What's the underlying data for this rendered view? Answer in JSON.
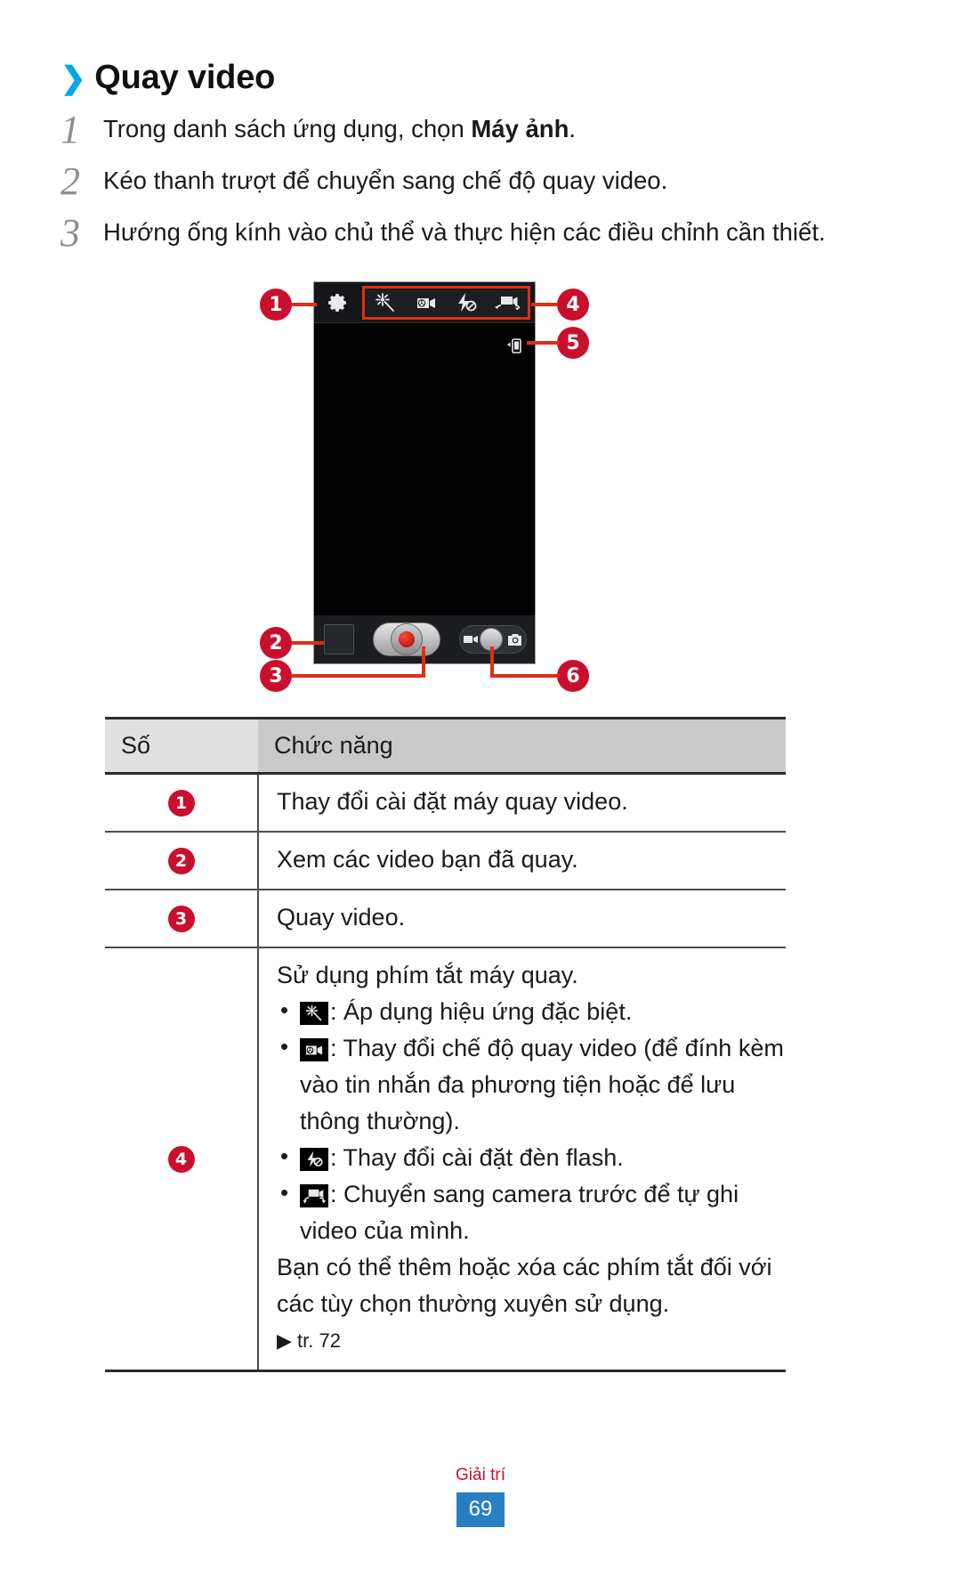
{
  "heading": {
    "chevron": "❯",
    "title": "Quay video"
  },
  "steps": [
    {
      "num": "1",
      "pre": "Trong danh sách ứng dụng, chọn ",
      "bold": "Máy ảnh",
      "post": "."
    },
    {
      "num": "2",
      "pre": "Kéo thanh trượt để chuyển sang chế độ quay video.",
      "bold": "",
      "post": ""
    },
    {
      "num": "3",
      "pre": "Hướng ống kính vào chủ thể và thực hiện các điều chỉnh cần thiết.",
      "bold": "",
      "post": ""
    }
  ],
  "figure": {
    "callouts": [
      "1",
      "2",
      "3",
      "4",
      "5",
      "6"
    ],
    "icons": {
      "settings": "gear-icon",
      "effects": "magic-wand-icon",
      "video_mode": "video-mode-icon",
      "flash_off": "flash-off-icon",
      "switch_camera": "switch-camera-icon",
      "storage": "storage-phone-icon",
      "thumbnail": "gallery-thumbnail",
      "record": "record-button",
      "mode_video": "video-camera-icon",
      "mode_photo": "photo-camera-icon"
    }
  },
  "table": {
    "headers": {
      "col1": "Số",
      "col2": "Chức năng"
    },
    "rows": [
      {
        "num": "1",
        "text": "Thay đổi cài đặt máy quay video."
      },
      {
        "num": "2",
        "text": "Xem các video bạn đã quay."
      },
      {
        "num": "3",
        "text": "Quay video."
      }
    ],
    "row4": {
      "num": "4",
      "intro": "Sử dụng phím tắt máy quay.",
      "bullets": [
        {
          "icon": "magic-wand-icon",
          "text": ": Áp dụng hiệu ứng đặc biệt."
        },
        {
          "icon": "video-mode-icon",
          "text": ": Thay đổi chế độ quay video (để đính kèm vào tin nhắn đa phương tiện hoặc để lưu thông thường)."
        },
        {
          "icon": "flash-off-icon",
          "text": ": Thay đổi cài đặt đèn flash."
        },
        {
          "icon": "switch-camera-icon",
          "text": ": Chuyển sang camera trước để tự ghi video của mình."
        }
      ],
      "outro": "Bạn có thể thêm hoặc xóa các phím tắt đối với các tùy chọn thường xuyên sử dụng.",
      "ref": "▶  tr. 72"
    }
  },
  "footer": {
    "caption": "Giải trí",
    "page": "69"
  },
  "colors": {
    "accent_blue": "#00a9e0",
    "callout_red": "#c8102e",
    "box_red": "#e02d16",
    "page_blue": "#2a7fc4"
  }
}
